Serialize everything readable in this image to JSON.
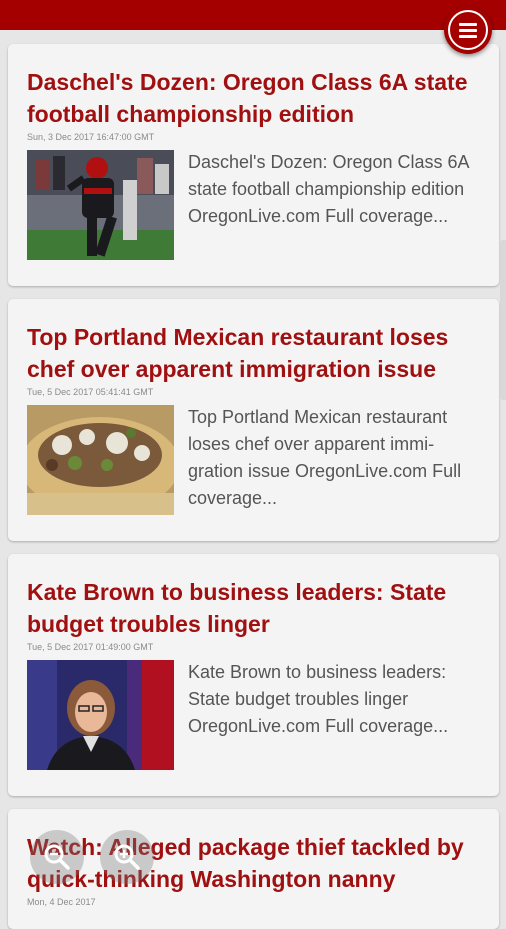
{
  "articles": [
    {
      "title": "Daschel's Dozen: Oregon Class 6A state football championship edition",
      "date": "Sun, 3 Dec 2017 16:47:00 GMT",
      "summary": "Daschel's Dozen: Oregon Class 6A state football championship edition  OregonLive.com  Full coverage...",
      "image": "football-player-photo"
    },
    {
      "title": "Top Portland Mexican restaurant loses chef over apparent immigration issue",
      "date": "Tue, 5 Dec 2017 05:41:41 GMT",
      "summary": "Top Portland Mexican restaurant loses chef over apparent immi-gration issue  OregonLive.com  Full coverage...",
      "image": "taco-photo"
    },
    {
      "title": "Kate Brown to business leaders: State budget troubles linger",
      "date": "Tue, 5 Dec 2017 01:49:00 GMT",
      "summary": "Kate Brown to business leaders: State budget troubles linger  OregonLive.com  Full coverage...",
      "image": "speaker-photo"
    },
    {
      "title": "Watch: Alleged package thief tackled by quick-thinking Washington nanny",
      "date": "Mon, 4 Dec 2017",
      "summary": "",
      "image": ""
    }
  ],
  "icons": {
    "menu": "hamburger-menu-icon",
    "zoom_out": "zoom-out-icon",
    "zoom_in": "zoom-in-icon"
  },
  "colors": {
    "brand": "#a50000",
    "title": "#a01010",
    "card_bg": "#f4f4f4",
    "page_bg": "#e6e6e6"
  }
}
